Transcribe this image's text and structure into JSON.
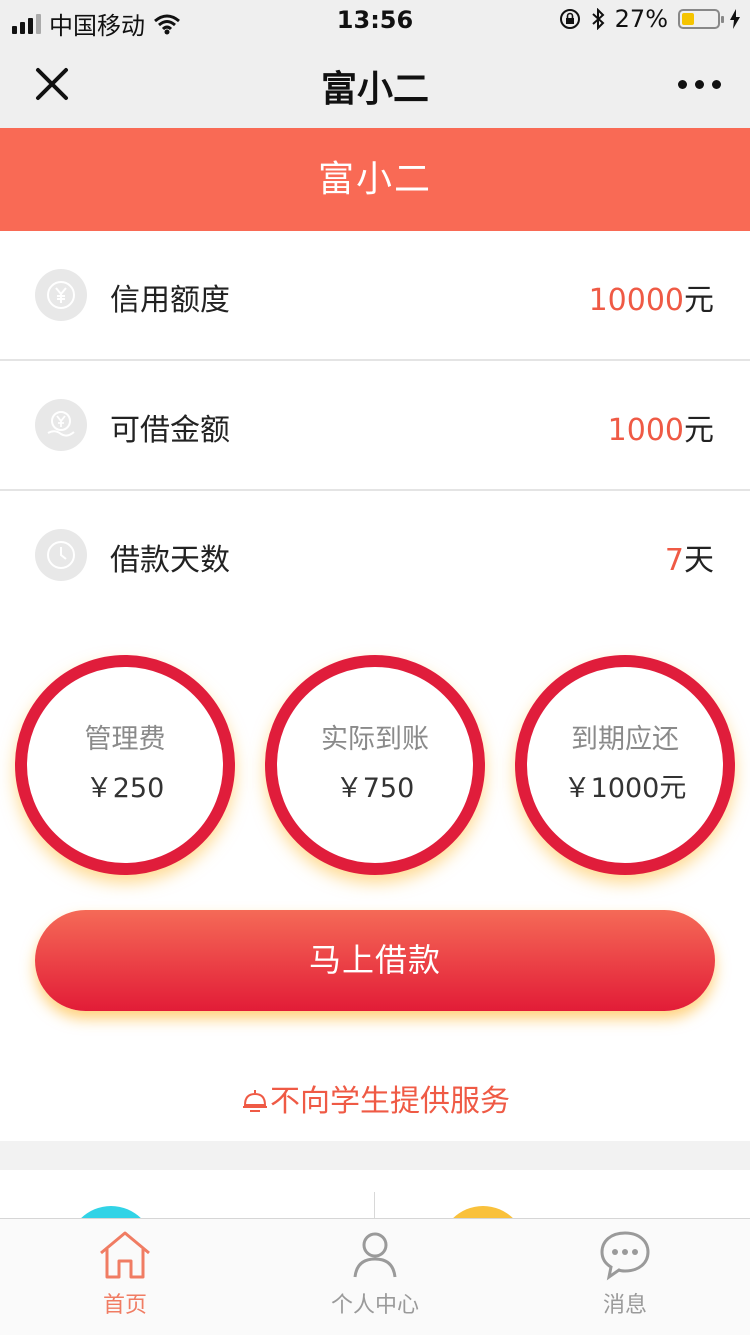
{
  "status_bar": {
    "carrier": "中国移动",
    "time": "13:56",
    "battery": "27%"
  },
  "nav": {
    "title": "富小二"
  },
  "banner": {
    "title": "富小二"
  },
  "info_rows": [
    {
      "icon": "yen-coin-icon",
      "label": "信用额度",
      "value": "10000",
      "unit": "元"
    },
    {
      "icon": "yen-hand-icon",
      "label": "可借金额",
      "value": "1000",
      "unit": "元"
    },
    {
      "icon": "clock-icon",
      "label": "借款天数",
      "value": "7",
      "unit": "天"
    }
  ],
  "fee_circles": [
    {
      "title": "管理费",
      "value": "￥250"
    },
    {
      "title": "实际到账",
      "value": "￥750"
    },
    {
      "title": "到期应还",
      "value": "￥1000元"
    }
  ],
  "borrow_button": "马上借款",
  "notice": "不向学生提供服务",
  "tabbar": [
    {
      "icon": "home-icon",
      "label": "首页",
      "active": true
    },
    {
      "icon": "person-icon",
      "label": "个人中心",
      "active": false
    },
    {
      "icon": "message-icon",
      "label": "消息",
      "active": false
    }
  ],
  "colors": {
    "accent": "#f96a55",
    "circle_border": "#e01d3b",
    "value_red": "#ef5a45"
  }
}
